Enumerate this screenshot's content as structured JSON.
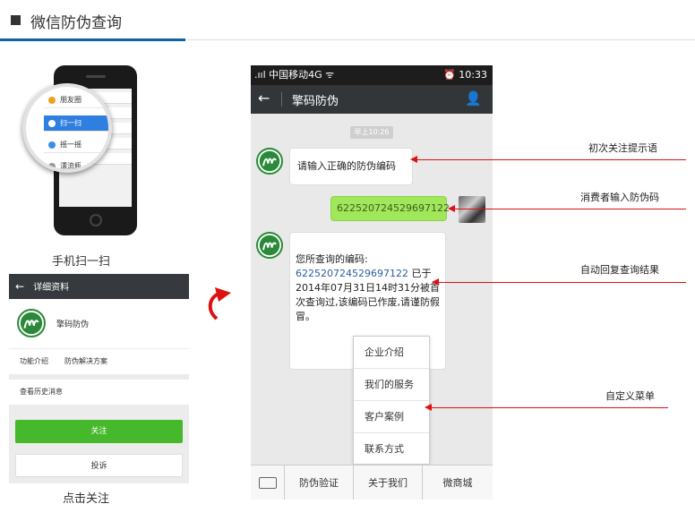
{
  "header": {
    "title": "微信防伪查询"
  },
  "scan_phone": {
    "menu_items": [
      "朋友圈",
      "扫一扫",
      "摇一摇",
      "漂流瓶"
    ],
    "caption": "手机扫一扫"
  },
  "profile": {
    "back_icon": "arrow-left-icon",
    "bar_title": "详细资料",
    "account_name": "擎码防伪",
    "func_label": "功能介绍",
    "func_value": "防伪解决方案",
    "history": "查看历史消息",
    "follow_button": "关注",
    "complain_button": "投诉",
    "caption": "点击关注"
  },
  "chat": {
    "status_left": ".ııl 中国移动4G ᯤ",
    "status_right": "⏰ 10:33",
    "title": "擎码防伪",
    "timestamp": "早上10:26",
    "msg_prompt": "请输入正确的防伪编码",
    "msg_code": "622520724529697122",
    "reply_lead": "您所查询的编码:",
    "reply_code": "622520724529697122",
    "reply_rest": " 已于2014年07月31日14时31分被首次查询过,该编码已作废,请谨防假冒。",
    "popup_menu": [
      "企业介绍",
      "我们的服务",
      "客户案例",
      "联系方式"
    ],
    "tabs": [
      "防伪验证",
      "关于我们",
      "微商城"
    ]
  },
  "annotations": [
    "初次关注提示语",
    "消费者输入防伪码",
    "自动回复查询结果",
    "自定义菜单"
  ],
  "colors": {
    "accent": "#0b62a8",
    "wechat_green": "#45b82b",
    "arrow_red": "#dd1111"
  }
}
